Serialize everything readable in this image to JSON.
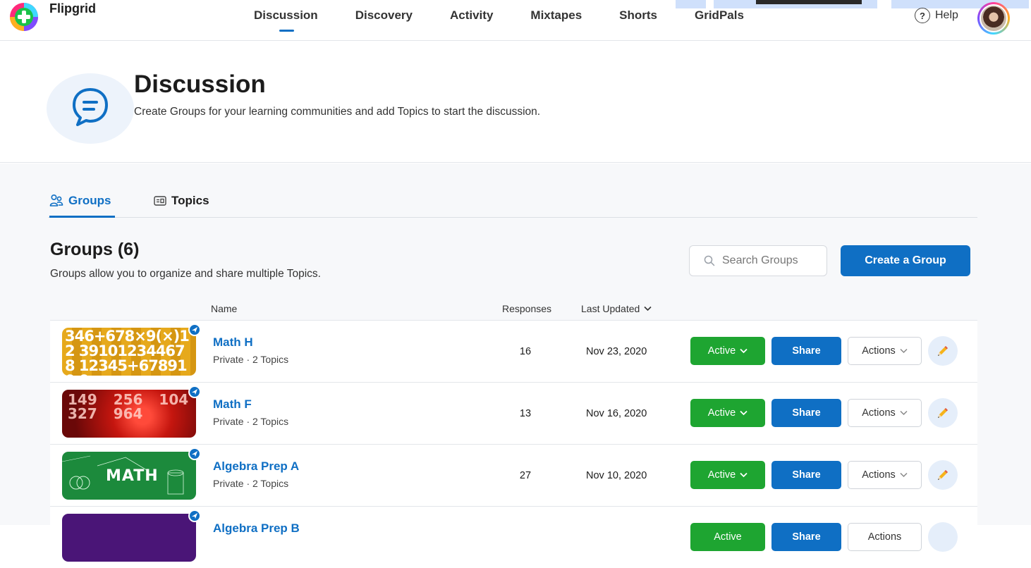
{
  "brand": {
    "name": "Flipgrid"
  },
  "nav": {
    "tabs": [
      {
        "label": "Discussion",
        "active": true
      },
      {
        "label": "Discovery"
      },
      {
        "label": "Activity"
      },
      {
        "label": "Mixtapes"
      },
      {
        "label": "Shorts"
      },
      {
        "label": "GridPals"
      }
    ],
    "help_label": "Help"
  },
  "header": {
    "title": "Discussion",
    "subtitle": "Create Groups for your learning communities and add Topics to start the discussion."
  },
  "subtabs": [
    {
      "label": "Groups",
      "active": true
    },
    {
      "label": "Topics"
    }
  ],
  "groups_section": {
    "title": "Groups (6)",
    "description": "Groups allow you to organize and share multiple Topics.",
    "search_placeholder": "Search Groups",
    "create_label": "Create a Group"
  },
  "table": {
    "columns": {
      "name": "Name",
      "responses": "Responses",
      "last_updated": "Last Updated"
    },
    "rows": [
      {
        "name": "Math H",
        "meta": "Private · 2 Topics",
        "responses": "16",
        "updated": "Nov 23, 2020",
        "status": "Active",
        "share": "Share",
        "actions": "Actions",
        "thumb_text": "346+678×9(×)12 391012344678 12345+678910 0"
      },
      {
        "name": "Math F",
        "meta": "Private · 2 Topics",
        "responses": "13",
        "updated": "Nov 16, 2020",
        "status": "Active",
        "share": "Share",
        "actions": "Actions",
        "thumb_text": "149 256 104 327 964"
      },
      {
        "name": "Algebra Prep A",
        "meta": "Private · 2 Topics",
        "responses": "27",
        "updated": "Nov 10, 2020",
        "status": "Active",
        "share": "Share",
        "actions": "Actions",
        "thumb_text": "MATH"
      },
      {
        "name": "Algebra Prep B",
        "meta": "",
        "responses": "",
        "updated": "",
        "status": "Active",
        "share": "Share",
        "actions": "Actions",
        "thumb_text": ""
      }
    ]
  },
  "colors": {
    "primary": "#0f6fc4",
    "active_green": "#1ea531",
    "content_bg": "#f7f8fa"
  },
  "icons": [
    "flipgrid-logo-icon",
    "help-icon",
    "avatar",
    "discussion-bubble-icon",
    "groups-icon",
    "topics-icon",
    "search-icon",
    "chevron-down-icon",
    "pencil-icon",
    "badge-icon"
  ]
}
